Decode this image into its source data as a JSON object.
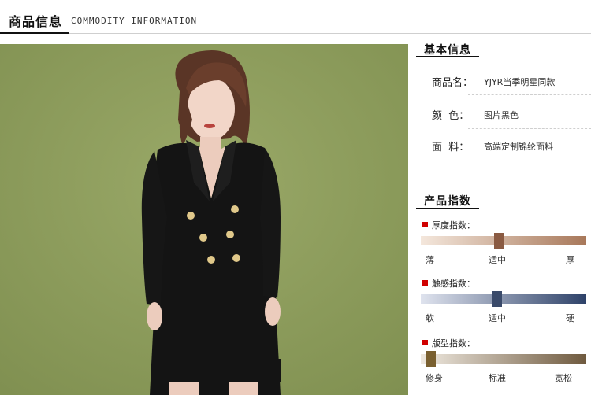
{
  "header": {
    "title_cn": "商品信息",
    "title_en": "COMMODITY INFORMATION"
  },
  "basic_info": {
    "title": "基本信息",
    "rows": [
      {
        "label": "商品名：",
        "value": "YJYR当季明星同款"
      },
      {
        "label": "颜  色：",
        "value": "图片黑色"
      },
      {
        "label": "面  料：",
        "value": "高端定制锦纶面料"
      }
    ]
  },
  "product_index": {
    "title": "产品指数",
    "items": [
      {
        "label": "厚度指数：",
        "levels": [
          "薄",
          "适中",
          "厚"
        ],
        "selected": "适中",
        "value": 0.47,
        "gradient": [
          "#f4e7dc",
          "#a8785a"
        ],
        "knob_color": "#8a5a42"
      },
      {
        "label": "触感指数：",
        "levels": [
          "软",
          "适中",
          "硬"
        ],
        "selected": "适中",
        "value": 0.46,
        "gradient": [
          "#dfe3ee",
          "#2e4269"
        ],
        "knob_color": "#3a4a6a"
      },
      {
        "label": "版型指数：",
        "levels": [
          "修身",
          "标准",
          "宽松"
        ],
        "selected": "修身",
        "value": 0.06,
        "gradient": [
          "#efe9e0",
          "#6f5a3f"
        ],
        "knob_color": "#7a6030"
      }
    ]
  },
  "colors": {
    "marker_red": "#d00000",
    "photo_background": "#8d9c5c"
  },
  "photo": {
    "icon": "model-photo"
  }
}
